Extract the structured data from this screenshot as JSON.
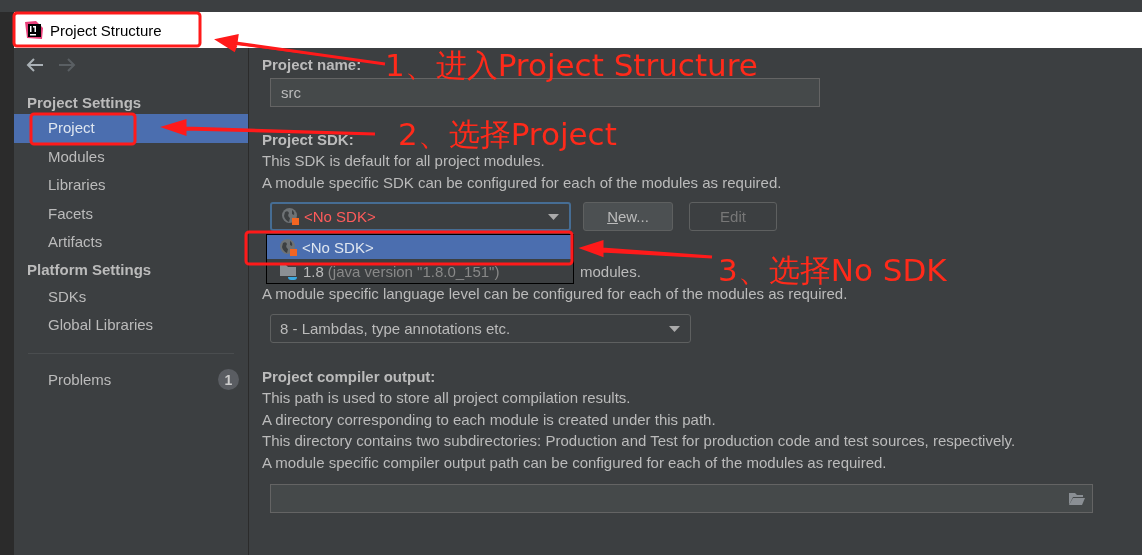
{
  "window": {
    "title": "Project Structure"
  },
  "sidebar": {
    "sections": [
      {
        "title": "Project Settings",
        "items": [
          {
            "label": "Project",
            "selected": true
          },
          {
            "label": "Modules",
            "selected": false
          },
          {
            "label": "Libraries",
            "selected": false
          },
          {
            "label": "Facets",
            "selected": false
          },
          {
            "label": "Artifacts",
            "selected": false
          }
        ]
      },
      {
        "title": "Platform Settings",
        "items": [
          {
            "label": "SDKs",
            "selected": false
          },
          {
            "label": "Global Libraries",
            "selected": false
          }
        ]
      }
    ],
    "problems": {
      "label": "Problems",
      "count": "1"
    }
  },
  "project_name": {
    "label": "Project name:",
    "value": "src"
  },
  "project_sdk": {
    "label": "Project SDK:",
    "lines": [
      "This SDK is default for all project modules.",
      "A module specific SDK can be configured for each of the modules as required."
    ],
    "dropdown": {
      "value": "<No SDK>"
    },
    "buttons": [
      {
        "label": "New...",
        "disabled": false
      },
      {
        "label": "Edit",
        "disabled": true
      }
    ],
    "popup": {
      "items": [
        {
          "kind": "none",
          "label": "<No SDK>",
          "selected": true
        },
        {
          "kind": "jdk",
          "label": "1.8",
          "detail": "(java version \"1.8.0_151\")",
          "selected": false
        }
      ]
    }
  },
  "language_level": {
    "partial_line": "modules.",
    "lines": [
      "A module specific language level can be configured for each of the modules as required."
    ],
    "dropdown": {
      "value": "8 - Lambdas, type annotations etc."
    }
  },
  "compiler_output": {
    "label": "Project compiler output:",
    "lines": [
      "This path is used to store all project compilation results.",
      "A directory corresponding to each module is created under this path.",
      "This directory contains two subdirectories: Production and Test for production code and test sources, respectively.",
      "A module specific compiler output path can be configured for each of the modules as required."
    ]
  },
  "annotations": [
    {
      "text": "1、进入Project Structure"
    },
    {
      "text": "2、选择Project"
    },
    {
      "text": "3、选择No SDK"
    }
  ]
}
